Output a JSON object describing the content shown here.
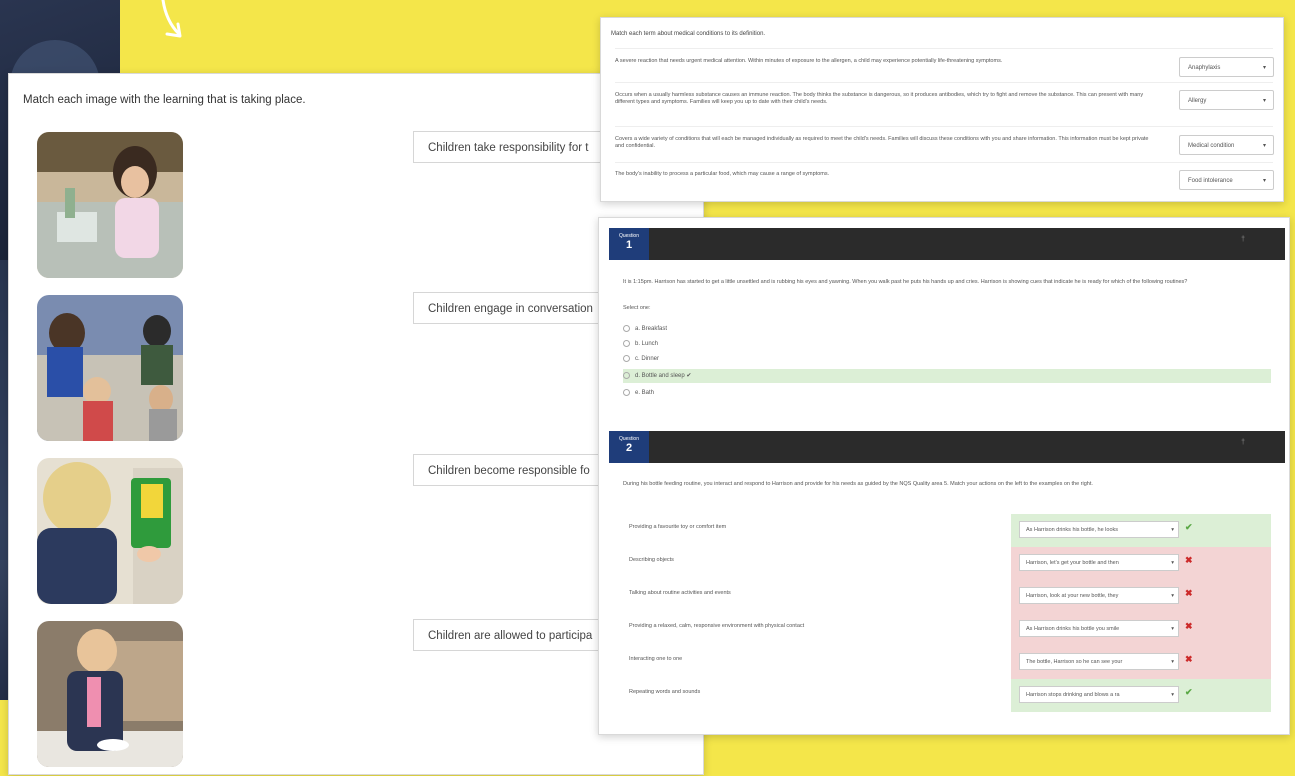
{
  "match_images_panel": {
    "instruction": "Match each image with the learning that is taking place.",
    "labels": [
      "Children take responsibility for t",
      "Children engage in conversation",
      "Children become responsible fo",
      "Children are allowed to participa"
    ]
  },
  "match_terms_panel": {
    "instruction": "Match each term about medical conditions to its definition.",
    "rows": [
      {
        "definition": "A severe reaction that needs urgent medical attention. Within minutes of exposure to the allergen, a child may experience potentially life-threatening symptoms.",
        "selected": "Anaphylaxis"
      },
      {
        "definition": "Occurs when a usually harmless substance causes an immune reaction. The body thinks the substance is dangerous, so it produces antibodies, which try to fight and remove the substance. This can present with many different types and symptoms. Families will keep you up to date with their child's needs.",
        "selected": "Allergy"
      },
      {
        "definition": "Covers a wide variety of conditions that will each be managed individually as required to meet the child's needs. Families will discuss these conditions with you and share information. This information must be kept private and confidential.",
        "selected": "Medical condition"
      },
      {
        "definition": "The body's inability to process a particular food, which may cause a range of symptoms.",
        "selected": "Food intolerance"
      }
    ]
  },
  "quiz_panel": {
    "question_label": "Question",
    "q1": {
      "number": "1",
      "text": "It is 1:15pm. Harrison has started to get a little unsettled and is rubbing his eyes and yawning. When you walk past he puts his hands up and cries. Harrison is showing cues that indicate he is ready for which of the following routines?",
      "select_one": "Select one:",
      "options": [
        "a. Breakfast",
        "b. Lunch",
        "c. Dinner",
        "d. Bottle and sleep ✔",
        "e. Bath"
      ],
      "correct_index": 3
    },
    "q2": {
      "number": "2",
      "text": "During his bottle feeding routine, you interact and respond to Harrison and provide for his needs as guided by the NQS Quality area 5. Match your actions on the left to the examples on the right.",
      "rows": [
        {
          "action": "Providing a favourite toy or comfort item",
          "answer": "As Harrison drinks his bottle, he looks",
          "status": "ok"
        },
        {
          "action": "Describing objects",
          "answer": "Harrison, let's get your bottle and then",
          "status": "bad"
        },
        {
          "action": "Talking about routine activities and events",
          "answer": "Harrison, look at your new bottle, they",
          "status": "bad"
        },
        {
          "action": "Providing a relaxed, calm, responsive environment with physical contact",
          "answer": "As Harrison drinks his bottle you smile",
          "status": "bad"
        },
        {
          "action": "Interacting one to one",
          "answer": "The bottle, Harrison so he can see your",
          "status": "bad"
        },
        {
          "action": "Repeating words and sounds",
          "answer": "Harrison stops drinking and blows a ra",
          "status": "ok"
        }
      ]
    }
  },
  "icons": {
    "ok": "✔",
    "bad": "✖",
    "chevron": "▾",
    "flag": "†"
  },
  "colors": {
    "background": "#f4e64a",
    "question_badge": "#1f3d7a",
    "correct": "#dcefd6",
    "incorrect": "#f3d4d4"
  }
}
